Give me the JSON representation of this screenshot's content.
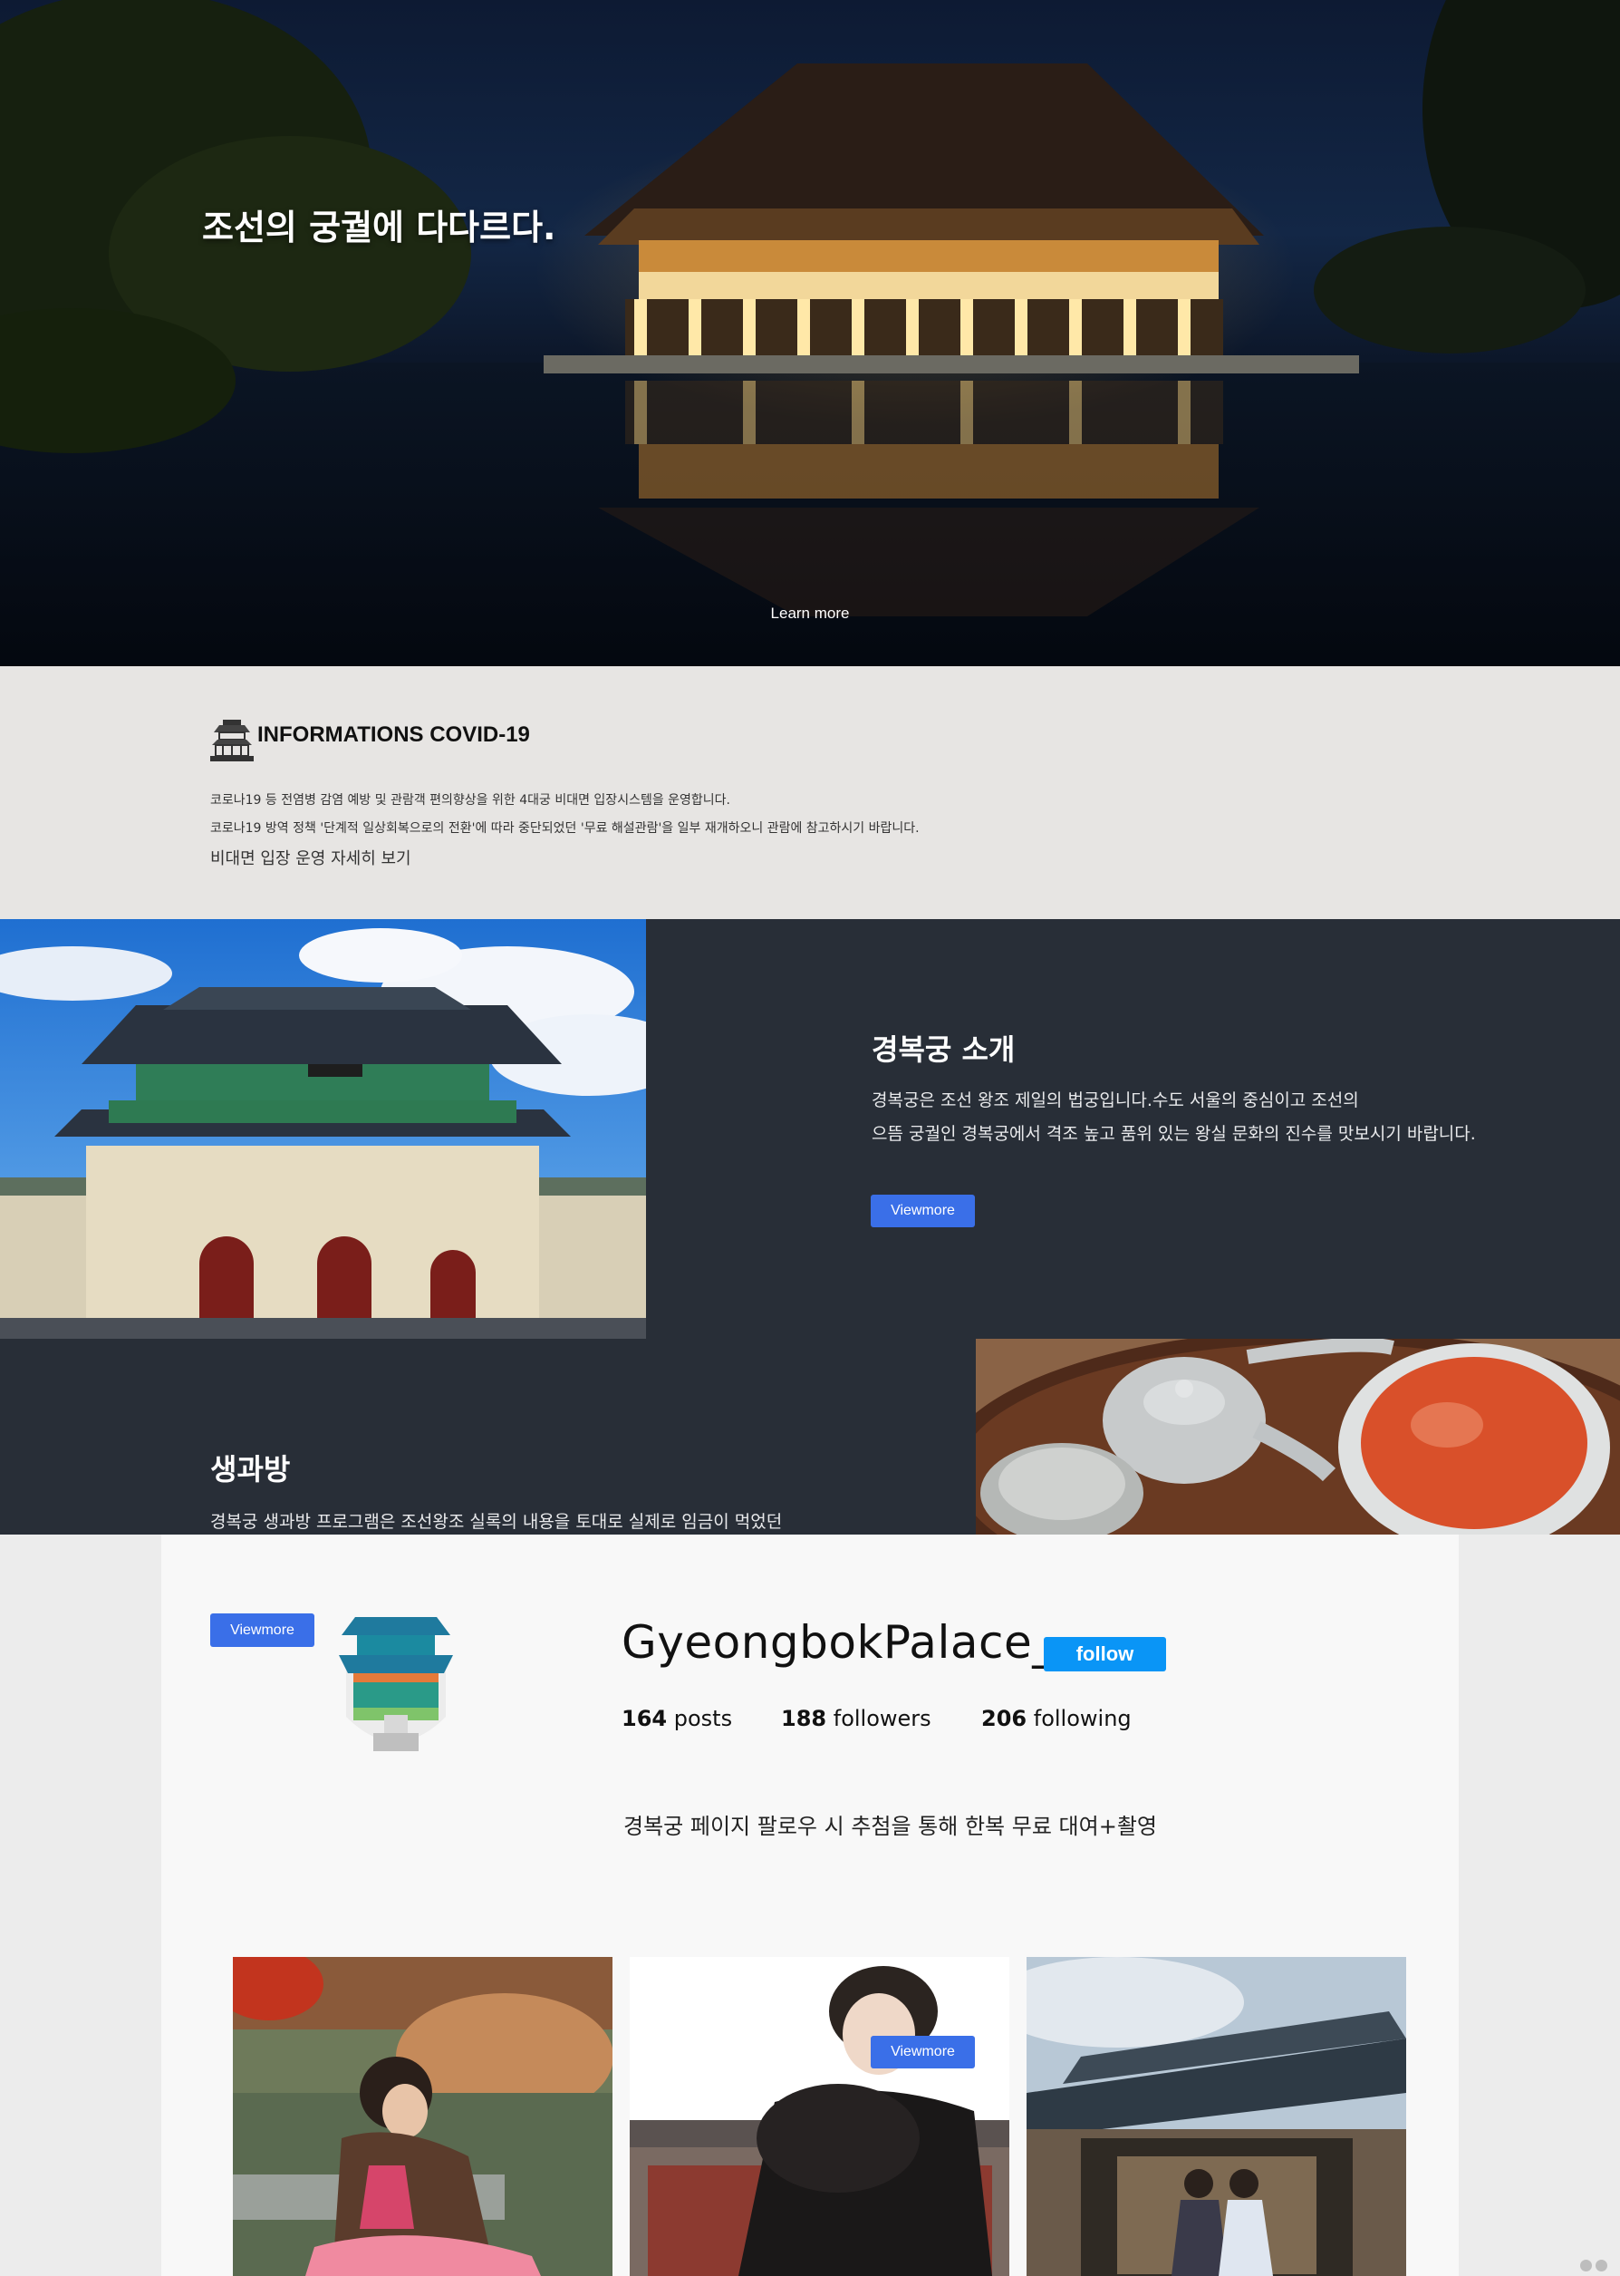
{
  "hero": {
    "title": "조선의 궁궐에 다다르다.",
    "learn_more": "Learn more"
  },
  "covid": {
    "title": "INFORMATIONS COVID-19",
    "line1": "코로나19 등 전염병 감염 예방 및 관람객 편의향상을 위한 4대궁 비대면 입장시스템을 운영합니다.",
    "line2": "코로나19 방역 정책 '단계적 일상회복으로의 전환'에 따라 중단되었던 '무료 해설관람'을 일부 재개하오니 관람에 참고하시기 바랍니다.",
    "link": "비대면 입장 운영 자세히 보기"
  },
  "intro": {
    "title": "경복궁 소개",
    "line1": "경복궁은 조선 왕조 제일의 법궁입니다.수도 서울의 중심이고 조선의",
    "line2": "으뜸 궁궐인 경복궁에서 격조 높고 품위 있는 왕실 문화의 진수를 맛보시기 바랍니다.",
    "button": "Viewmore"
  },
  "saeng": {
    "title": "생과방",
    "line1": "경복궁 생과방 프로그램은 조선왕조 실록의 내용을 토대로 실제로 임금이 먹었던"
  },
  "profile": {
    "button": "Viewmore",
    "username": "GyeongbokPalace_",
    "follow": "follow",
    "posts_count": "164",
    "posts_label": "posts",
    "followers_count": "188",
    "followers_label": "followers",
    "following_count": "206",
    "following_label": "following",
    "bio": "경복궁 페이지 팔로우 시 추첨을 통해 한복 무료 대여+촬영"
  },
  "gallery": {
    "button": "Viewmore"
  },
  "colors": {
    "accent_blue": "#3a6fe8",
    "follow_blue": "#0a95f6",
    "dark_panel": "#282e37"
  }
}
